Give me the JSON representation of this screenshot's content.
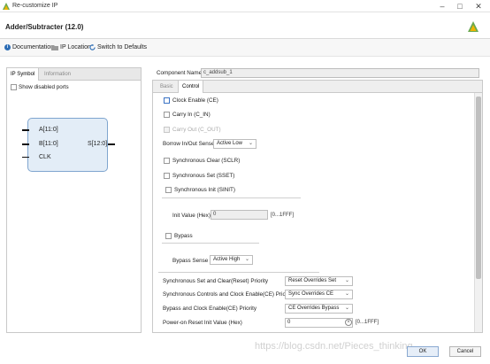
{
  "window": {
    "title": "Re-customize IP",
    "controls": [
      "–",
      "□",
      "✕"
    ]
  },
  "header": {
    "title": "Adder/Subtracter (12.0)"
  },
  "links": {
    "documentation": "Documentation",
    "ip_location": "IP Location",
    "switch_defaults": "Switch to Defaults"
  },
  "left_panel": {
    "tabs": [
      "IP Symbol",
      "Information"
    ],
    "show_disabled_ports": "Show disabled ports",
    "symbol": {
      "inputs": [
        "A[11:0]",
        "B[11:0]",
        "CLK"
      ],
      "output": "S[12:0]"
    }
  },
  "component": {
    "label": "Component Name",
    "value": "c_addsub_1"
  },
  "tabs": [
    "Basic",
    "Control"
  ],
  "control": {
    "clock_enable": "Clock Enable (CE)",
    "carry_in": "Carry In (C_IN)",
    "carry_out": "Carry Out (C_OUT)",
    "borrow_label": "Borrow In/Out Sense",
    "borrow_value": "Active Low",
    "sclr": "Synchronous Clear (SCLR)",
    "sset": "Synchronous Set (SSET)",
    "sinit": "Synchronous Init (SINIT)",
    "init_label": "Init Value (Hex)",
    "init_value": "0",
    "init_range": "[0...1FFF]",
    "bypass": "Bypass",
    "bypass_sense_label": "Bypass Sense",
    "bypass_sense_value": "Active High",
    "priorities": [
      {
        "label": "Synchronous Set and Clear(Reset) Priority",
        "value": "Reset Overrides Set"
      },
      {
        "label": "Synchronous Controls and Clock Enable(CE) Priority",
        "value": "Sync Overrides CE"
      },
      {
        "label": "Bypass and Clock Enable(CE) Priority",
        "value": "CE Overrides Bypass"
      }
    ],
    "power_on_label": "Power-on Reset Init Value (Hex)",
    "power_on_value": "0",
    "power_on_range": "[0...1FFF]"
  },
  "buttons": {
    "ok": "OK",
    "cancel": "Cancel"
  },
  "watermark": "https://blog.csdn.net/Pieces_thinking"
}
